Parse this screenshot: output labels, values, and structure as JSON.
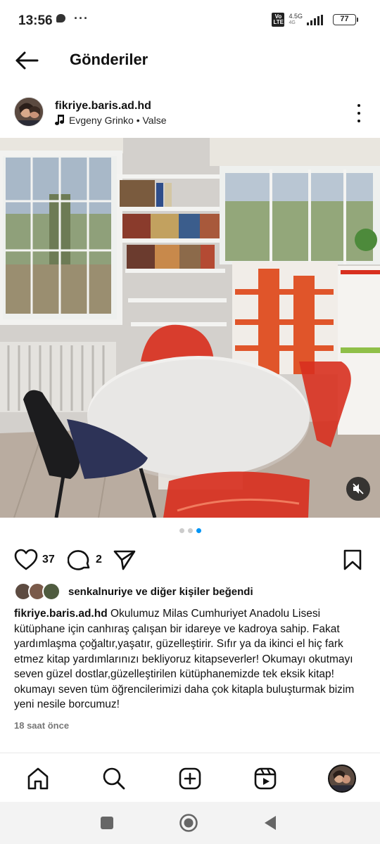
{
  "status_bar": {
    "time": "13:56",
    "network_type": "4.5G",
    "network_sub": "4G",
    "volte": "Vo LTE",
    "battery": "77"
  },
  "header": {
    "title": "Gönderiler",
    "back_icon": "arrow-left-icon"
  },
  "post": {
    "username": "fikriye.baris.ad.hd",
    "music": "Evgeny Grinko • Valse",
    "more_icon": "more-vertical-icon",
    "carousel": {
      "count": 3,
      "active_index": 2
    },
    "likes_count": "37",
    "comments_count": "2",
    "liked_by": "senkalnuriye",
    "liked_by_suffix": "ve diğer kişiler beğendi",
    "caption_user": "fikriye.baris.ad.hd",
    "caption_text": "Okulumuz Milas Cumhuriyet Anadolu Lisesi kütüphane için canhıraş çalışan bir idareye ve kadroya sahip. Fakat yardımlaşma çoğaltır,yaşatır, güzelleştirir. Sıfır ya da ikinci el hiç fark etmez kitap yardımlarınızı bekliyoruz kitapseverler! Okumayı okutmayı seven güzel dostlar,güzelleştirilen kütüphanemizde tek eksik kitap! okumayı seven tüm öğrencilerimizi daha çok kitapla buluşturmak bizim yeni nesile borcumuz!",
    "timestamp": "18 saat önce"
  },
  "bottom_nav": {
    "items": [
      "home-icon",
      "search-icon",
      "create-post-icon",
      "reels-icon",
      "profile-avatar"
    ]
  },
  "system_nav": [
    "recents-square-icon",
    "home-circle-icon",
    "back-triangle-icon"
  ],
  "colors": {
    "accent": "#0095f6",
    "chair_red": "#d8301f",
    "shelf_orange": "#e0552a"
  }
}
